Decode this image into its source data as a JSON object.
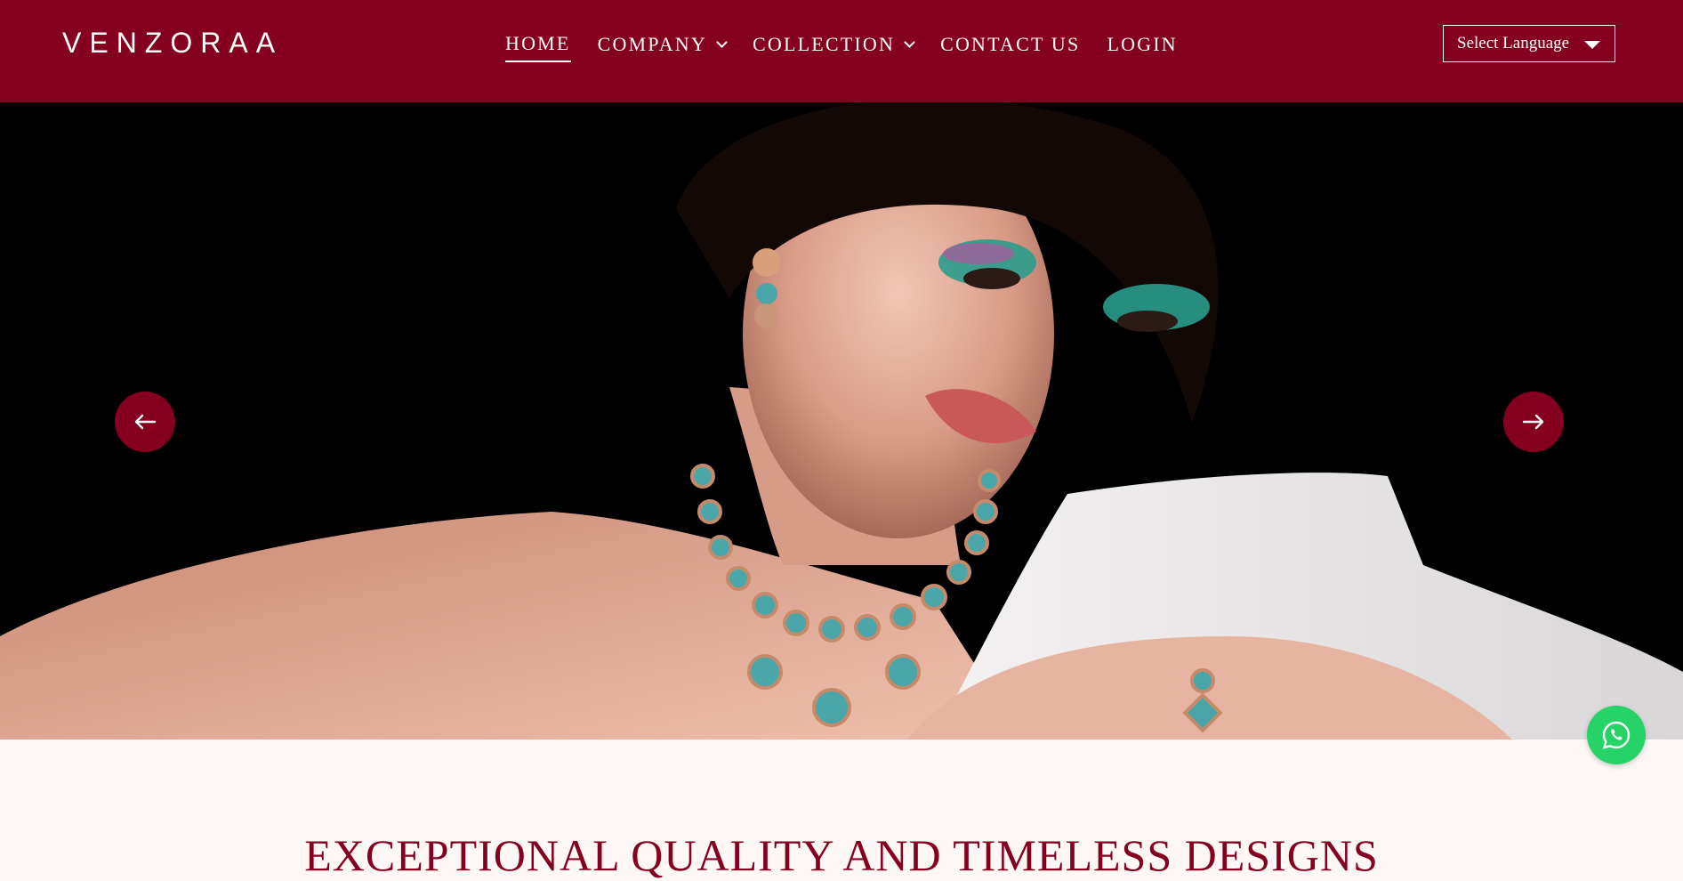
{
  "colors": {
    "brand": "#85001f",
    "background": "#fdf7f5",
    "whatsapp": "#25d366"
  },
  "header": {
    "logo": "VENZORAA",
    "nav": [
      {
        "label": "HOME",
        "active": true,
        "dropdown": false
      },
      {
        "label": "COMPANY",
        "active": false,
        "dropdown": true
      },
      {
        "label": "COLLECTION",
        "active": false,
        "dropdown": true
      },
      {
        "label": "CONTACT US",
        "active": false,
        "dropdown": false
      },
      {
        "label": "LOGIN",
        "active": false,
        "dropdown": false
      }
    ],
    "language_select": "Select Language"
  },
  "hero": {
    "prev_icon": "arrow-left-icon",
    "next_icon": "arrow-right-icon"
  },
  "whatsapp": {
    "icon": "whatsapp-icon"
  },
  "section": {
    "heading": "EXCEPTIONAL QUALITY AND TIMELESS DESIGNS"
  }
}
